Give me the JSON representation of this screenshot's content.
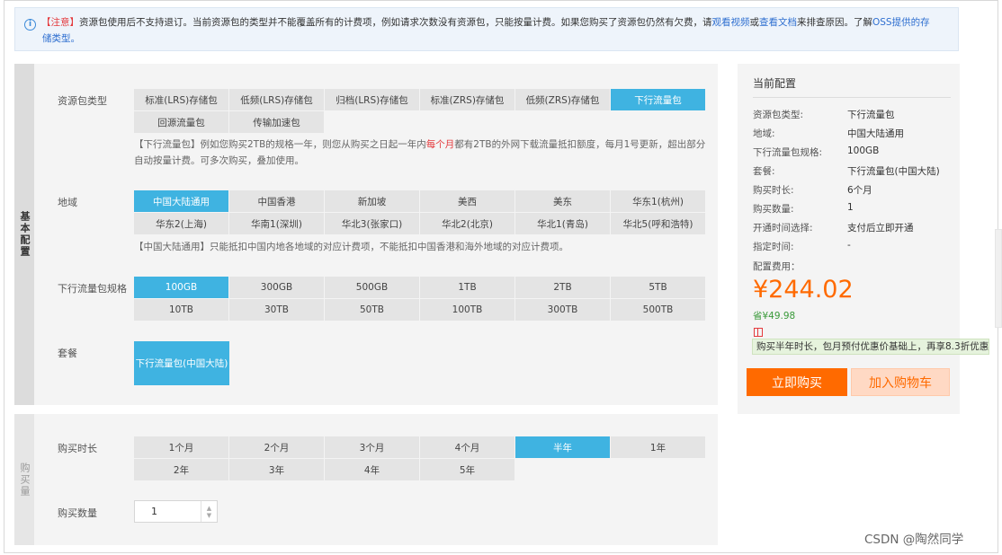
{
  "notice": {
    "tag": "【注意】",
    "text1": "资源包使用后不支持退订。当前资源包的类型并不能覆盖所有的计费项，例如请求次数没有资源包，只能按量计费。如果您购买了资源包仍然有欠费，请",
    "link1": "观看视频",
    "or": "或",
    "link2": "查看文档",
    "text2": "来排查原因。了解",
    "link3a": "OSS提供的存",
    "link3b": "储类型。"
  },
  "basic": {
    "side_label": "基本配置",
    "resource_type": {
      "label": "资源包类型",
      "options": [
        "标准(LRS)存储包",
        "低频(LRS)存储包",
        "归档(LRS)存储包",
        "标准(ZRS)存储包",
        "低频(ZRS)存储包",
        "下行流量包",
        "回源流量包",
        "传输加速包"
      ],
      "selected": "下行流量包",
      "hint_a": "【下行流量包】例如您购买2TB的规格一年，则您从购买之日起一年内",
      "hint_red": "每个月",
      "hint_b": "都有2TB的外网下载流量抵扣额度，每月1号更新，超出部分",
      "hint_c": "自动按量计费。可多次购买，叠加使用。"
    },
    "region": {
      "label": "地域",
      "options": [
        "中国大陆通用",
        "中国香港",
        "新加坡",
        "美西",
        "美东",
        "华东1(杭州)",
        "华东2(上海)",
        "华南1(深圳)",
        "华北3(张家口)",
        "华北2(北京)",
        "华北1(青岛)",
        "华北5(呼和浩特)"
      ],
      "selected": "中国大陆通用",
      "hint": "【中国大陆通用】只能抵扣中国内地各地域的对应计费项，不能抵扣中国香港和海外地域的对应计费项。"
    },
    "spec": {
      "label": "下行流量包规格",
      "options": [
        "100GB",
        "300GB",
        "500GB",
        "1TB",
        "2TB",
        "5TB",
        "10TB",
        "30TB",
        "50TB",
        "100TB",
        "300TB",
        "500TB"
      ],
      "selected": "100GB"
    },
    "package": {
      "label": "套餐",
      "option": "下行流量包(中国大陆)"
    }
  },
  "buy": {
    "side_label": "购买量",
    "duration": {
      "label": "购买时长",
      "options": [
        "1个月",
        "2个月",
        "3个月",
        "4个月",
        "半年",
        "1年",
        "2年",
        "3年",
        "4年",
        "5年"
      ],
      "selected": "半年"
    },
    "quantity": {
      "label": "购买数量",
      "value": "1"
    }
  },
  "summary": {
    "title": "当前配置",
    "rows": [
      {
        "k": "资源包类型:",
        "v": "下行流量包"
      },
      {
        "k": "地域:",
        "v": "中国大陆通用"
      },
      {
        "k": "下行流量包规格:",
        "v": "100GB"
      },
      {
        "k": "套餐:",
        "v": "下行流量包(中国大陆)"
      },
      {
        "k": "购买时长:",
        "v": "6个月"
      },
      {
        "k": "购买数量:",
        "v": "1"
      },
      {
        "k": "开通时间选择:",
        "v": "支付后立即开通"
      },
      {
        "k": "指定时间:",
        "v": "-"
      }
    ],
    "fee_label": "配置费用：",
    "price": "¥244.02",
    "saving": "省¥49.98",
    "promo": "购买半年时长，包月预付优惠价基础上，再享8.3折优惠",
    "buy_button": "立即购买",
    "cart_button": "加入购物车"
  },
  "watermark": "CSDN @陶然同学",
  "colors": {
    "selected": "#3fb3e1",
    "price": "#ff6a00",
    "saving": "#3a9a3a"
  }
}
